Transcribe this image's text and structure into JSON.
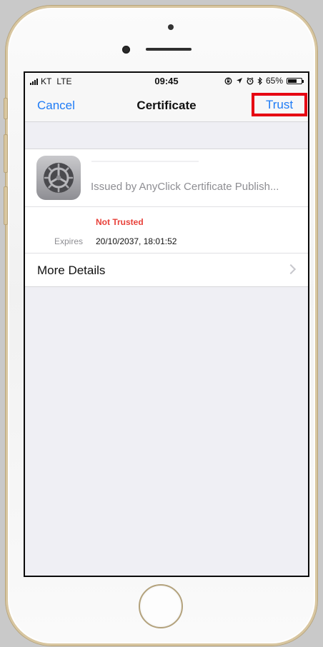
{
  "statusbar": {
    "carrier": "KT",
    "network": "LTE",
    "time": "09:45",
    "battery": "65%",
    "battery_level": 0.65
  },
  "navbar": {
    "cancel_label": "Cancel",
    "title": "Certificate",
    "trust_label": "Trust",
    "highlight_color": "#e60012"
  },
  "certificate": {
    "issuer": "Issued by AnyClick Certificate Publish...",
    "status": "Not Trusted",
    "expires_label": "Expires",
    "expires_value": "20/10/2037, 18:01:52"
  },
  "more_details": {
    "label": "More Details"
  },
  "colors": {
    "link": "#1f7cf6",
    "warning": "#e8413a",
    "secondary_text": "#8e8e93",
    "background": "#efeff4"
  },
  "icons": {
    "certificate": "settings-gear-icon",
    "more_details": "chevron-right-icon"
  }
}
